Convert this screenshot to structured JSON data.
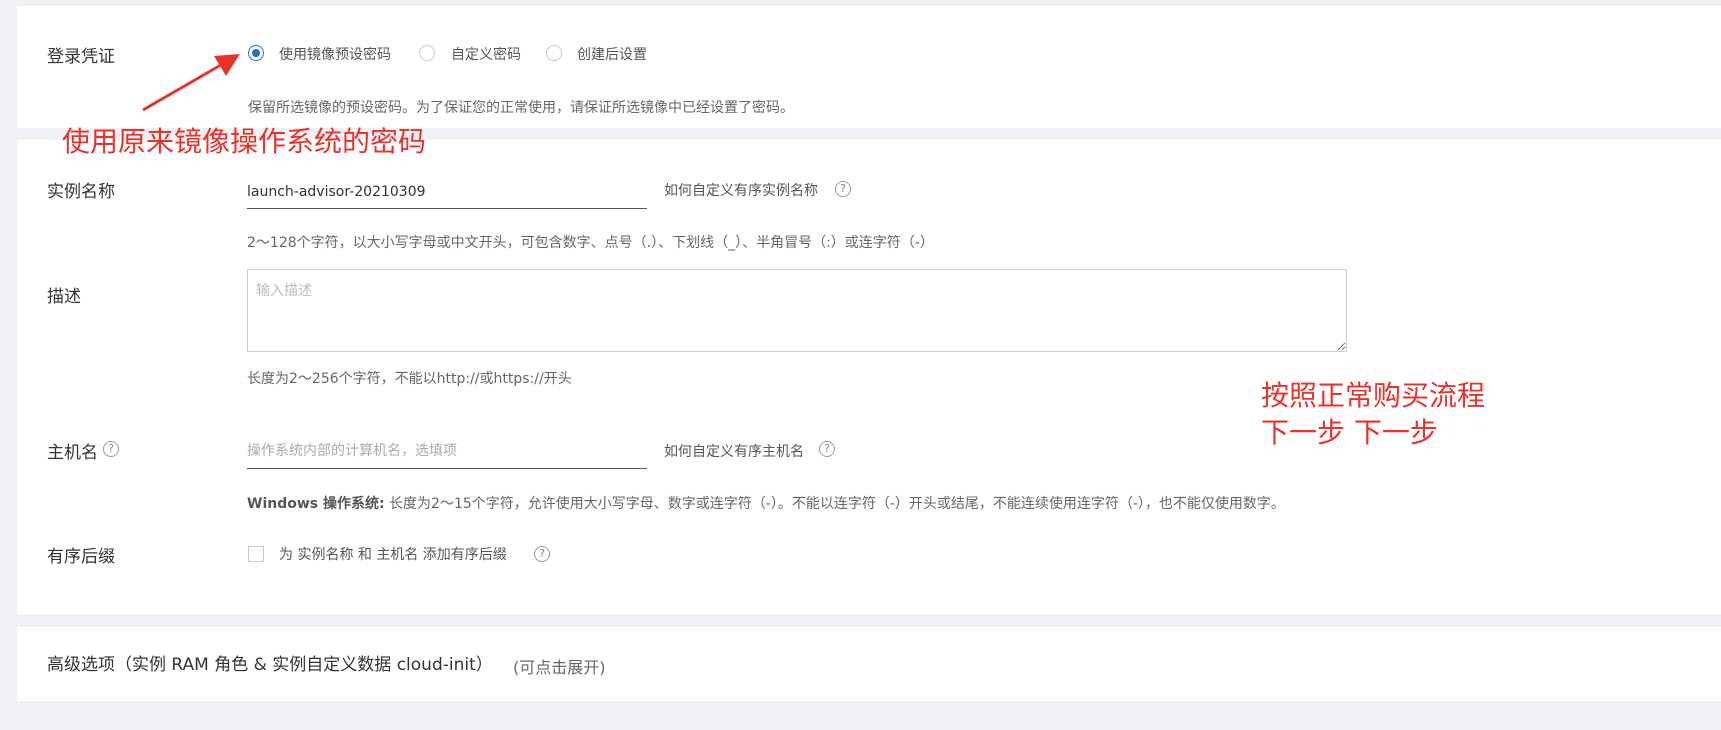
{
  "login": {
    "label": "登录凭证",
    "options": [
      "使用镜像预设密码",
      "自定义密码",
      "创建后设置"
    ],
    "selected": "使用镜像预设密码",
    "hint": "保留所选镜像的预设密码。为了保证您的正常使用，请保证所选镜像中已经设置了密码。"
  },
  "instance_name": {
    "label": "实例名称",
    "value": "launch-advisor-20210309",
    "link": "如何自定义有序实例名称",
    "hint": "2～128个字符，以大小写字母或中文开头，可包含数字、点号（.）、下划线（_）、半角冒号（:）或连字符（-）"
  },
  "description": {
    "label": "描述",
    "placeholder": "输入描述",
    "hint": "长度为2～256个字符，不能以http://或https://开头"
  },
  "hostname": {
    "label": "主机名",
    "placeholder": "操作系统内部的计算机名，选填项",
    "link": "如何自定义有序主机名",
    "hint_bold": "Windows 操作系统:",
    "hint": "长度为2～15个字符，允许使用大小写字母、数字或连字符（-）。不能以连字符（-）开头或结尾，不能连续使用连字符（-），也不能仅使用数字。"
  },
  "suffix": {
    "label": "有序后缀",
    "checkbox_label": "为 实例名称 和 主机名 添加有序后缀"
  },
  "advanced": {
    "title": "高级选项（实例 RAM 角色 & 实例自定义数据 cloud-init）",
    "expand": "(可点击展开)"
  },
  "annotations": {
    "password_note": "使用原来镜像操作系统的密码",
    "flow_line1": "按照正常购买流程",
    "flow_line2": "下一步 下一步",
    "color": "#e8332d"
  },
  "colors": {
    "accent": "#1e6fd9",
    "background": "#f0f1f4"
  }
}
